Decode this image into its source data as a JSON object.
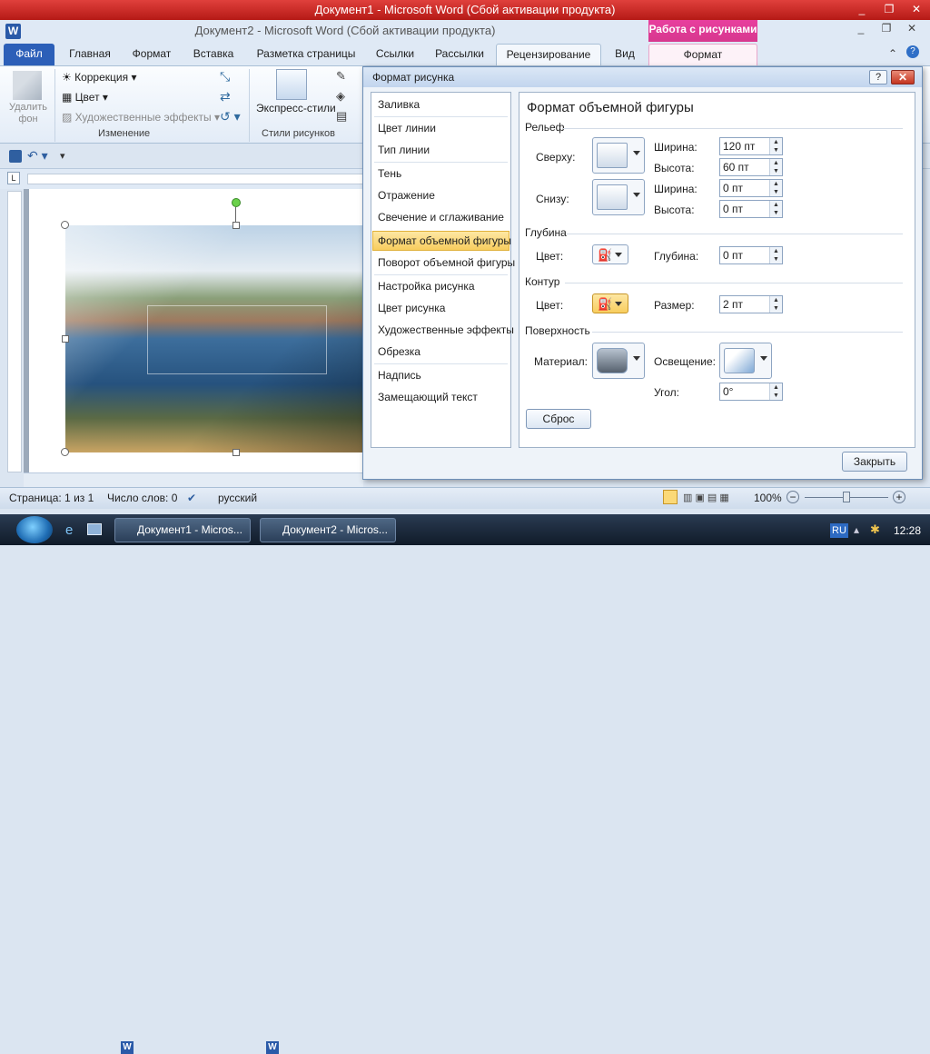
{
  "word": {
    "title": "Документ1 - Microsoft Word (Сбой активации продукта)",
    "title2": "Документ2 - Microsoft Word (Сбой активации продукта)",
    "context_tab_header": "Работа с рисунками",
    "window_controls": [
      "_",
      "❐",
      "✕"
    ],
    "tabs": {
      "file": "Файл",
      "home": "Главная",
      "format1": "Формат",
      "insert": "Вставка",
      "layout": "Разметка страницы",
      "refs": "Ссылки",
      "mail": "Рассылки",
      "review": "Рецензирование",
      "view": "Вид",
      "format_ctx": "Формат"
    },
    "ribbon": {
      "remove_bg": "Удалить фон",
      "remove_bg_line1": "Удалить",
      "remove_bg_line2": "фон",
      "corrections": "Коррекция",
      "color": "Цвет",
      "artistic": "Художественные эффекты",
      "group_adjust": "Изменение",
      "quick_styles": "Экспресс-стили",
      "group_styles": "Стили рисунков"
    },
    "status": {
      "page": "Страница: 1 из 1",
      "words": "Число слов: 0",
      "lang": "русский",
      "zoom": "100%"
    },
    "taskbar": {
      "item1": "Документ1 - Micros...",
      "item2": "Документ2 - Micros...",
      "lang": "RU",
      "time": "12:28"
    }
  },
  "dialog": {
    "title": "Формат рисунка",
    "help": "?",
    "close": "✕",
    "nav": [
      "Заливка",
      "Цвет линии",
      "Тип линии",
      "Тень",
      "Отражение",
      "Свечение и сглаживание",
      "Формат объемной фигуры",
      "Поворот объемной фигуры",
      "Настройка рисунка",
      "Цвет рисунка",
      "Художественные эффекты",
      "Обрезка",
      "Надпись",
      "Замещающий текст"
    ],
    "selected_nav": "Формат объемной фигуры",
    "panel_title": "Формат объемной фигуры",
    "bevel": {
      "heading": "Рельеф",
      "top_label": "Сверху:",
      "bottom_label": "Снизу:",
      "width_label": "Ширина:",
      "height_label": "Высота:",
      "top_width": "120 пт",
      "top_height": "60 пт",
      "bottom_width": "0 пт",
      "bottom_height": "0 пт"
    },
    "depth": {
      "heading": "Глубина",
      "color_label": "Цвет:",
      "depth_label": "Глубина:",
      "depth_value": "0 пт"
    },
    "contour": {
      "heading": "Контур",
      "color_label": "Цвет:",
      "size_label": "Размер:",
      "size_value": "2 пт"
    },
    "surface": {
      "heading": "Поверхность",
      "material_label": "Материал:",
      "lighting_label": "Освещение:",
      "angle_label": "Угол:",
      "angle_value": "0°"
    },
    "reset": "Сброс",
    "close_button": "Закрыть"
  }
}
